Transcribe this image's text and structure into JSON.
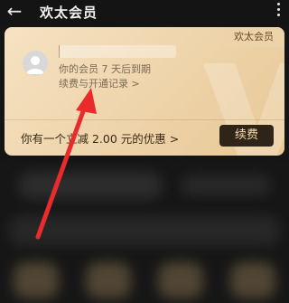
{
  "header": {
    "back_icon": "back-arrow-icon",
    "title": "欢太会员",
    "more_icon": "more-vertical-icon"
  },
  "card": {
    "badge": "欢太会员",
    "expiry": "你的会员 7 天后到期",
    "history_link": "续费与开通记录 >",
    "promo": "你有一个立减 2.00 元的优惠 >",
    "renew_label": "续费"
  },
  "colors": {
    "card_gold": "#efd6ae",
    "renew_button": "#2e2417",
    "annotation_arrow": "#ea2b2b"
  }
}
